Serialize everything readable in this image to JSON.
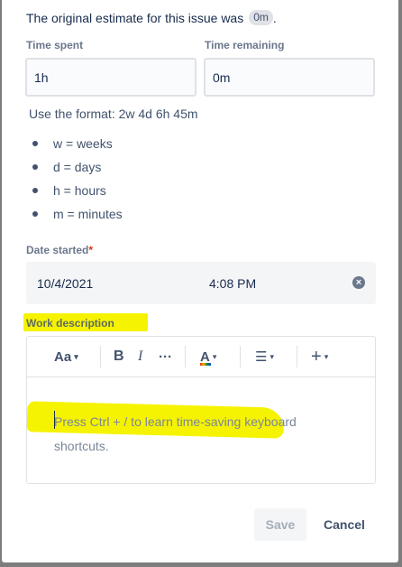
{
  "estimate": {
    "text": "The original estimate for this issue was",
    "value": "0m",
    "after": "."
  },
  "time_spent": {
    "label": "Time spent",
    "value": "1h"
  },
  "time_remaining": {
    "label": "Time remaining",
    "value": "0m"
  },
  "format_hint": "Use the format: 2w 4d 6h 45m",
  "units": [
    "w = weeks",
    "d = days",
    "h = hours",
    "m = minutes"
  ],
  "date_started": {
    "label": "Date started",
    "required_mark": "*",
    "date": "10/4/2021",
    "time": "4:08 PM"
  },
  "work_description": {
    "label": "Work description",
    "placeholder_line1": "Press Ctrl + / to learn time-saving keyboard",
    "placeholder_line2": "shortcuts."
  },
  "toolbar": {
    "text_style": "Aa",
    "bold": "B",
    "italic": "I",
    "more": "···",
    "color": "A",
    "list": "☰",
    "insert": "+"
  },
  "buttons": {
    "save": "Save",
    "cancel": "Cancel"
  },
  "colors": {
    "highlight": "#f6f300",
    "required": "#de350b"
  }
}
